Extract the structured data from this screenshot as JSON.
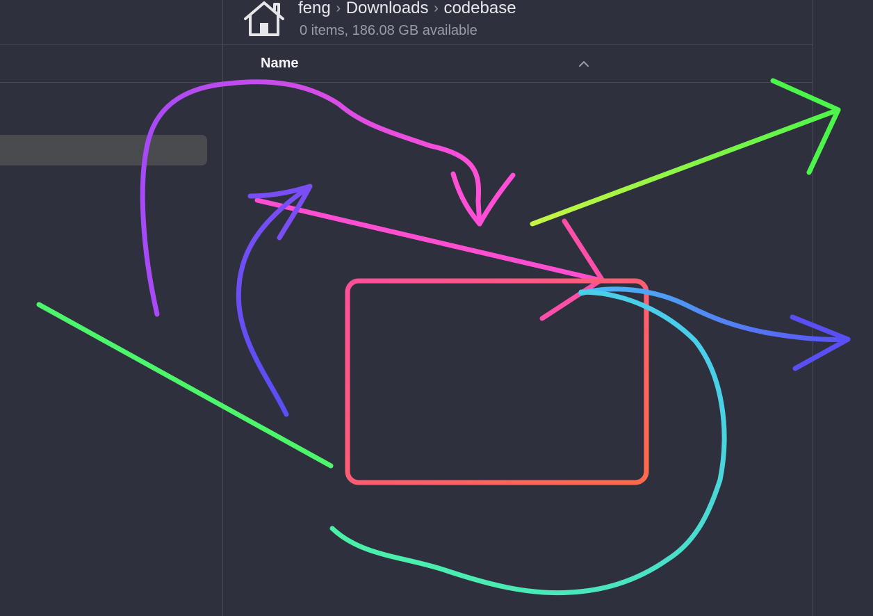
{
  "window": {
    "breadcrumb": [
      "feng",
      "Downloads",
      "codebase"
    ],
    "breadcrumb_separator": "›",
    "status": "0 items, 186.08 GB available"
  },
  "list": {
    "columns": [
      {
        "label": "Name",
        "sort": "ascending"
      }
    ]
  },
  "icons": {
    "location": "home-icon",
    "sort": "chevron-up-icon"
  },
  "colors": {
    "background": "#2e313d",
    "selection": "#4a4b4f",
    "text_primary": "#e8e8ec",
    "text_secondary": "#9a9ca6"
  },
  "annotations": [
    {
      "kind": "arc-arrow",
      "color": "#b04af5"
    },
    {
      "kind": "arrow",
      "color": "#ff4fcf"
    },
    {
      "kind": "arrow",
      "color": "#5a4ef5"
    },
    {
      "kind": "line",
      "color": "#4cf56a"
    },
    {
      "kind": "rounded-rectangle",
      "color": "#ff4f7a"
    },
    {
      "kind": "arrow",
      "color": "#a8f544"
    },
    {
      "kind": "arrow",
      "color": "#ff4fa8"
    },
    {
      "kind": "arc-arrow",
      "color": "#4a7af5"
    },
    {
      "kind": "curve",
      "color": "#4af0f5"
    }
  ]
}
